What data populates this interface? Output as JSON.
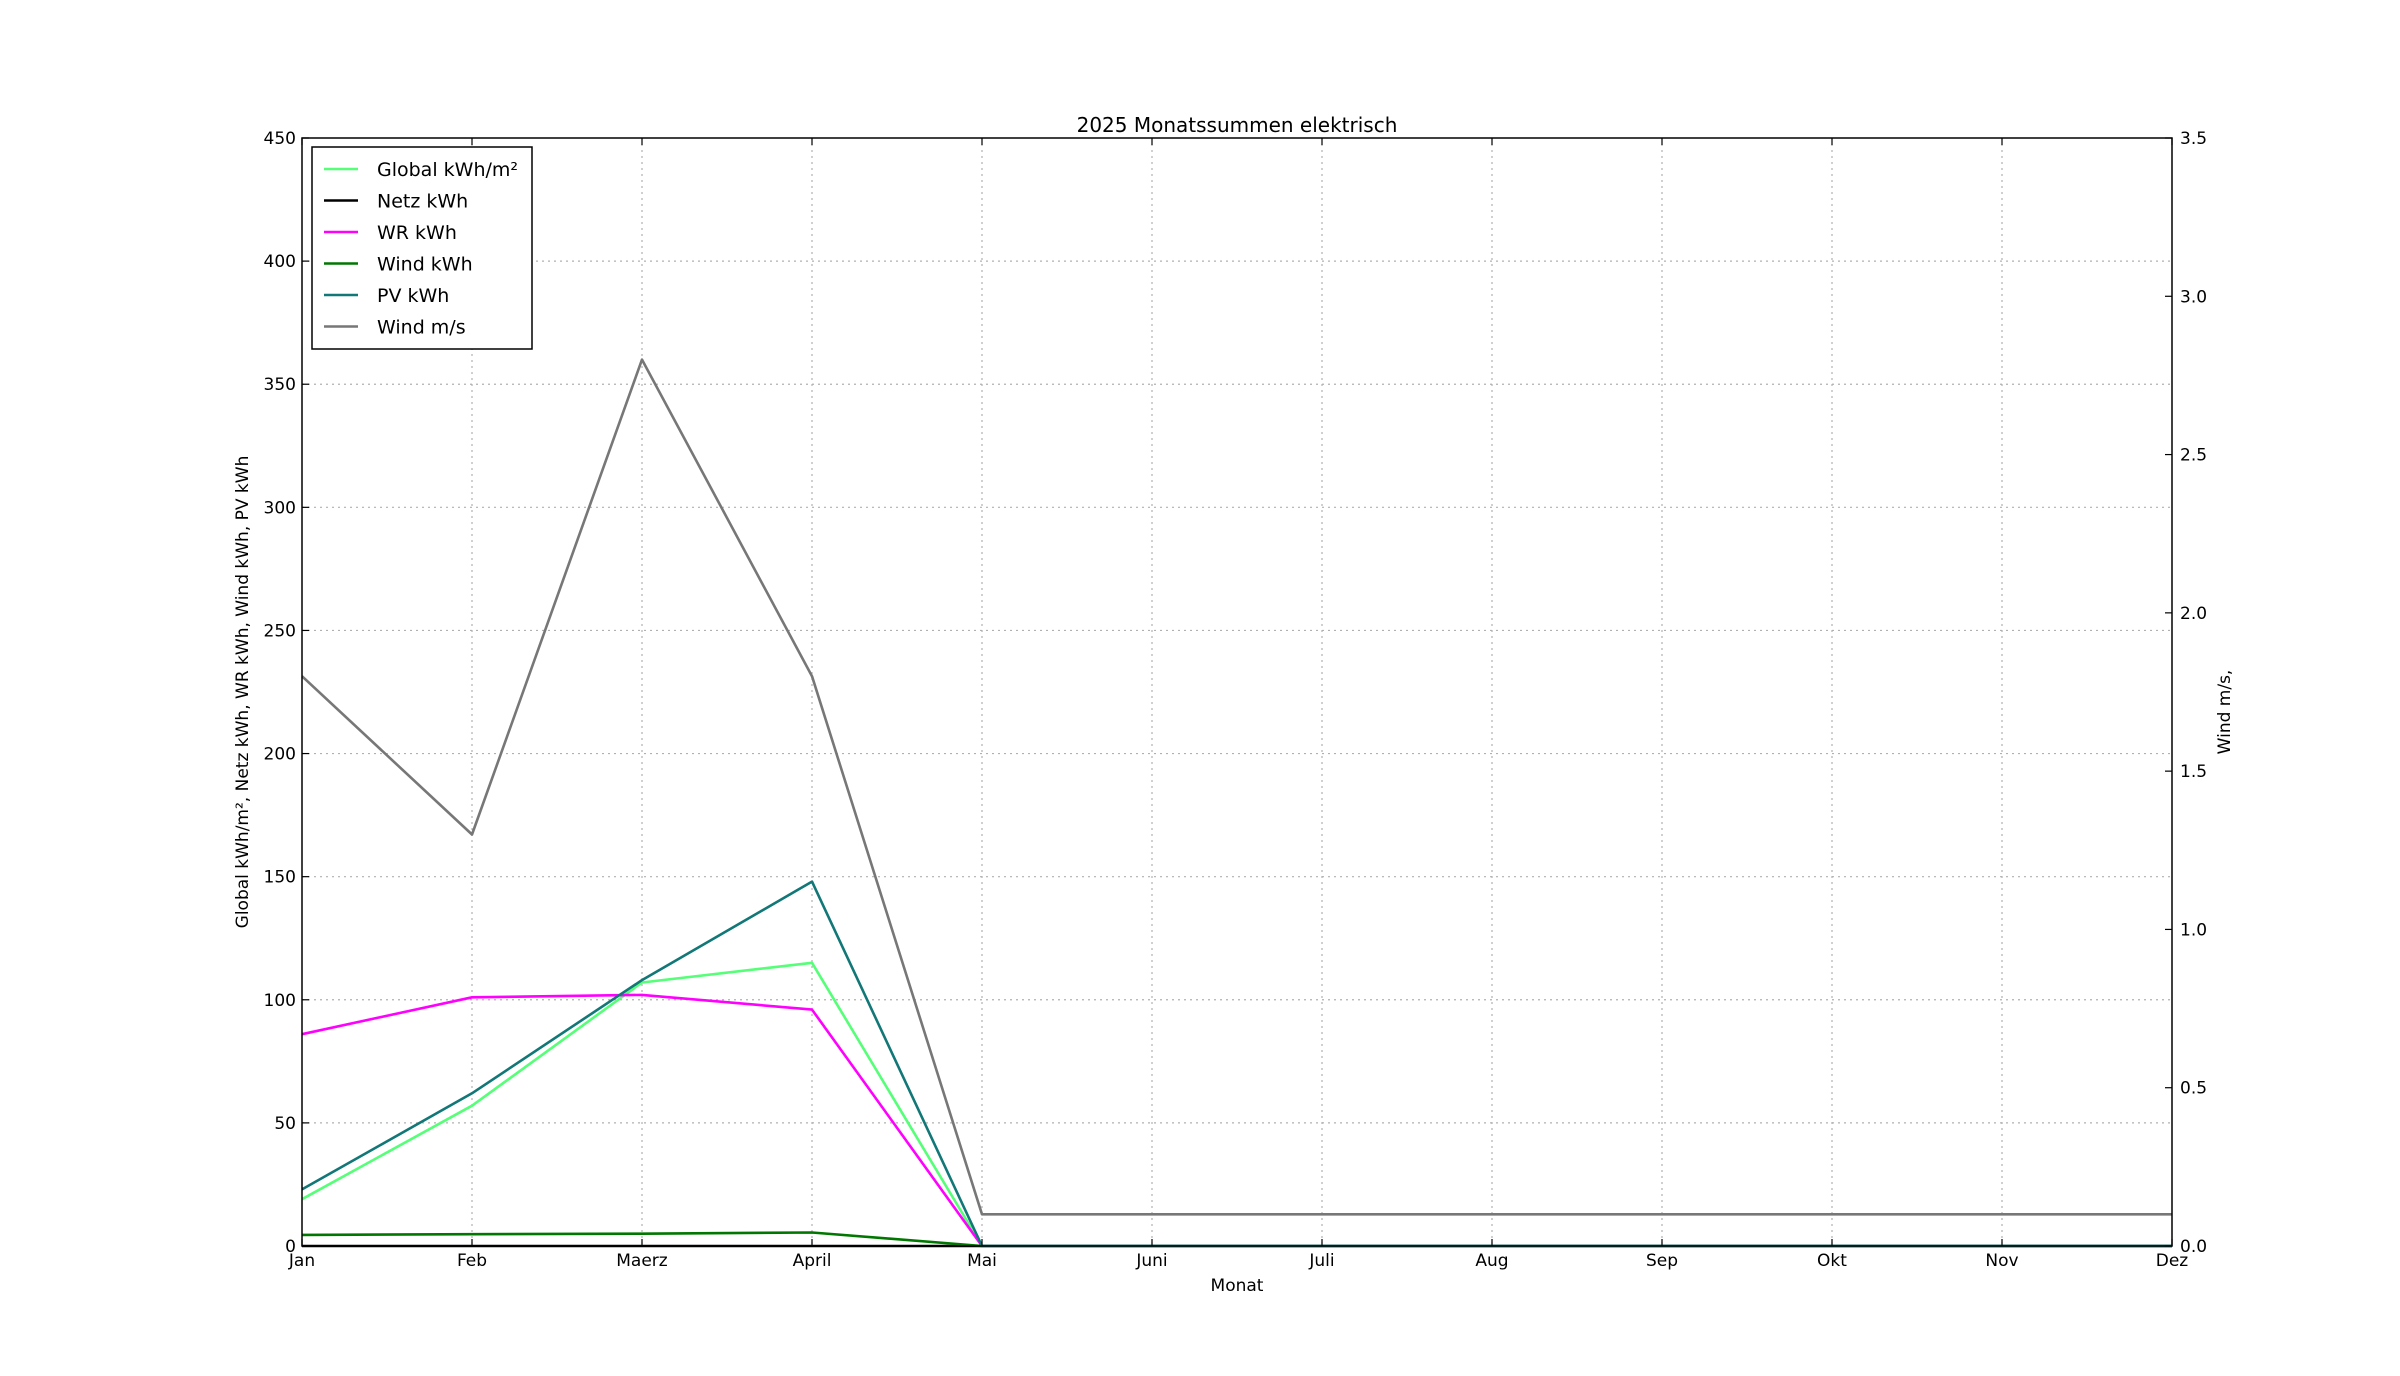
{
  "chart_data": {
    "type": "line",
    "title": "2025 Monatssummen elektrisch",
    "xlabel": "Monat",
    "ylabel": "Global kWh/m², Netz kWh, WR kWh, Wind kWh, PV kWh",
    "ylabel_right": "Wind m/s,",
    "categories": [
      "Jan",
      "Feb",
      "Maerz",
      "April",
      "Mai",
      "Juni",
      "Juli",
      "Aug",
      "Sep",
      "Okt",
      "Nov",
      "Dez"
    ],
    "ylim": [
      0,
      450
    ],
    "ylim_right": [
      0,
      3.5
    ],
    "yticks": [
      "0",
      "50",
      "100",
      "150",
      "200",
      "250",
      "300",
      "350",
      "400",
      "450"
    ],
    "yticks_right": [
      "0.0",
      "0.5",
      "1.0",
      "1.5",
      "2.0",
      "2.5",
      "3.0",
      "3.5"
    ],
    "grid": true,
    "legend_position": "top-left",
    "series": [
      {
        "name": "Global kWh/m²",
        "axis": "left",
        "color": "#55ff77",
        "values": [
          19,
          57,
          107,
          115,
          0,
          0,
          0,
          0,
          0,
          0,
          0,
          0
        ]
      },
      {
        "name": "Netz kWh",
        "axis": "left",
        "color": "#000000",
        "values": [
          0,
          0,
          0,
          0,
          0,
          0,
          0,
          0,
          0,
          0,
          0,
          0
        ]
      },
      {
        "name": "WR kWh",
        "axis": "left",
        "color": "#ff00ff",
        "values": [
          86,
          101,
          102,
          96,
          0,
          0,
          0,
          0,
          0,
          0,
          0,
          0
        ]
      },
      {
        "name": "Wind kWh",
        "axis": "left",
        "color": "#007700",
        "values": [
          4.5,
          4.8,
          5,
          5.5,
          0,
          0,
          0,
          0,
          0,
          0,
          0,
          0
        ]
      },
      {
        "name": "PV kWh",
        "axis": "left",
        "color": "#117777",
        "values": [
          23,
          62,
          108,
          148,
          0,
          0,
          0,
          0,
          0,
          0,
          0,
          0
        ]
      },
      {
        "name": "Wind m/s",
        "axis": "right",
        "color": "#777777",
        "values": [
          1.8,
          1.3,
          2.8,
          1.8,
          0.1,
          0.1,
          0.1,
          0.1,
          0.1,
          0.1,
          0.1,
          0.1
        ]
      }
    ]
  }
}
